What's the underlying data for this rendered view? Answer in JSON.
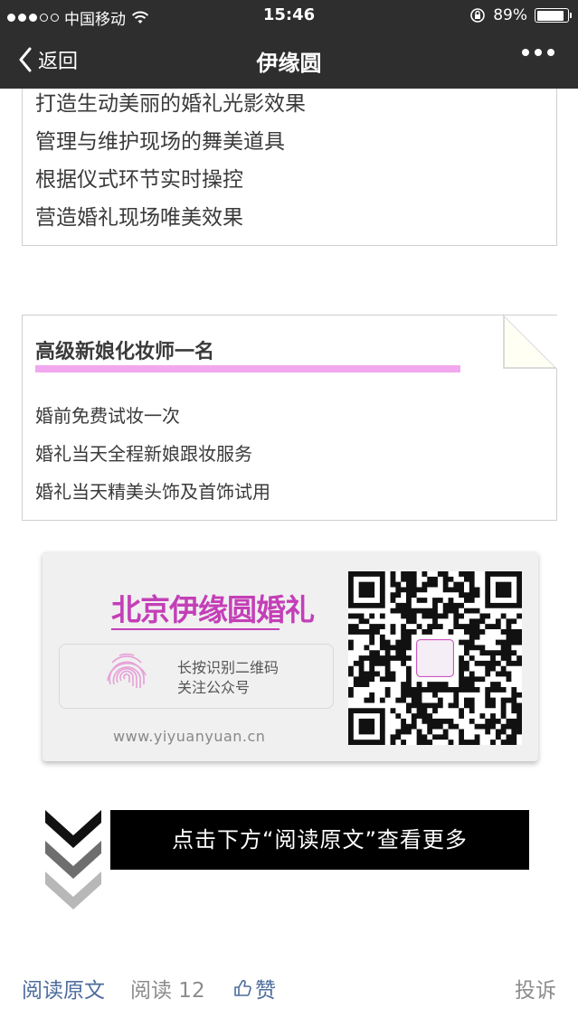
{
  "status_bar": {
    "carrier": "中国移动",
    "time": "15:46",
    "battery_text": "89%",
    "battery_level": 0.89
  },
  "nav": {
    "back_label": "返回",
    "title": "伊缘圆"
  },
  "card1": {
    "lines": [
      "打造生动美丽的婚礼光影效果",
      "管理与维护现场的舞美道具",
      "根据仪式环节实时操控",
      "营造婚礼现场唯美效果"
    ]
  },
  "card2": {
    "heading": "高级新娘化妆师一名",
    "items": [
      "婚前免费试妆一次",
      "婚礼当天全程新娘跟妆服务",
      "婚礼当天精美头饰及首饰试用"
    ]
  },
  "promo": {
    "brand": "北京伊缘圆婚礼",
    "scan_line1": "长按识别二维码",
    "scan_line2": "关注公众号",
    "url": "www.yiyuanyuan.cn"
  },
  "banner": {
    "text": "点击下方“阅读原文”查看更多"
  },
  "footer": {
    "read_original": "阅读原文",
    "read_count": "阅读 12",
    "like": "赞",
    "report": "投诉"
  },
  "colors": {
    "nav_bg": "#2e2e2e",
    "accent_pink": "#c43fb7",
    "highlight_pink": "#f2a8ef",
    "link_blue": "#4e6d9c"
  }
}
